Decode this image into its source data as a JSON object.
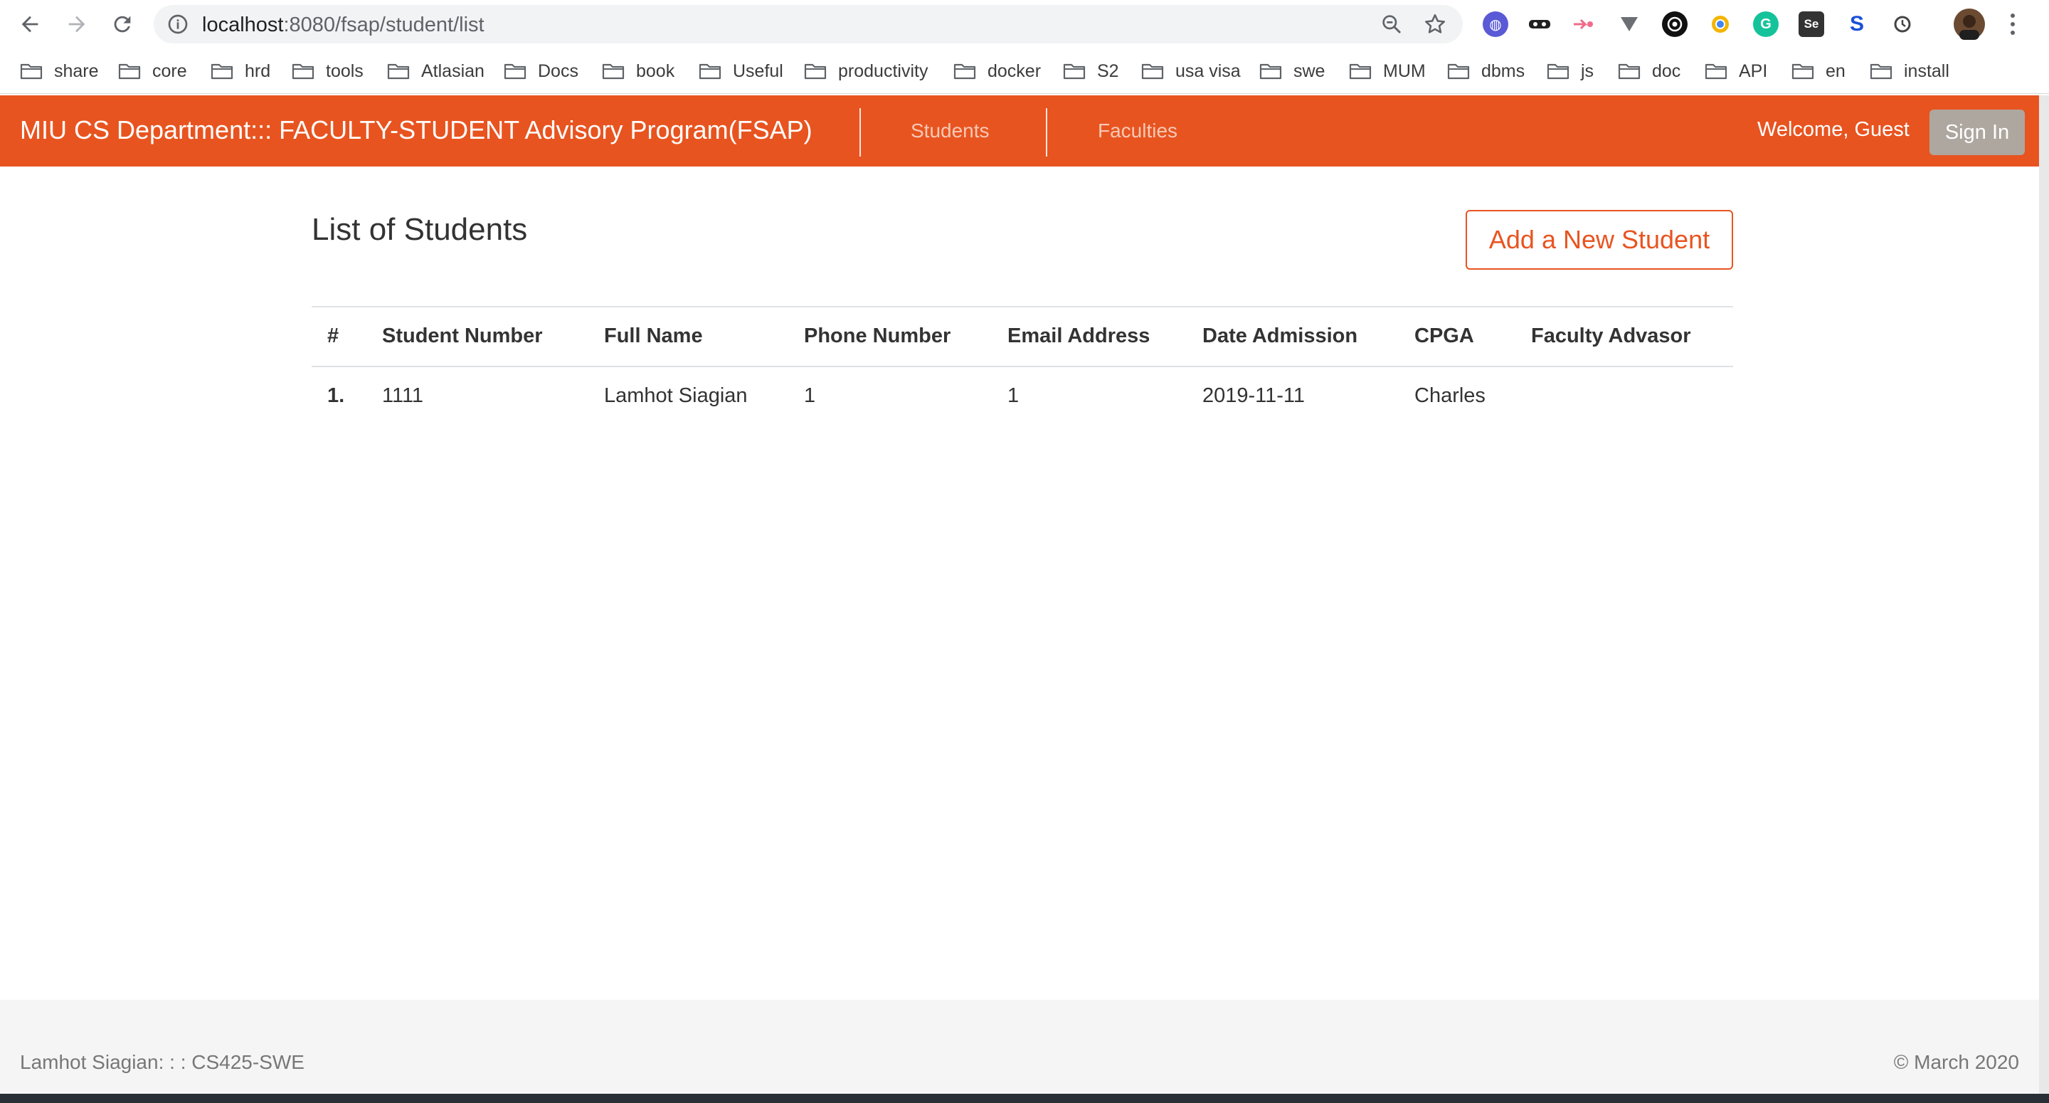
{
  "browser": {
    "url_host": "localhost",
    "url_path": ":8080/fsap/student/list",
    "extensions": [
      "globe-ext",
      "mask-ext",
      "pink-arrow-ext",
      "v-ext",
      "target-ext",
      "chrome-ext",
      "grammarly-ext",
      "se-ext",
      "s-ext",
      "sync-ext",
      "profile-avatar"
    ],
    "bookmarks": [
      "share",
      "core",
      "hrd",
      "tools",
      "Atlasian",
      "Docs",
      "book",
      "Useful",
      "productivity",
      "docker",
      "S2",
      "usa visa",
      "swe",
      "MUM",
      "dbms",
      "js",
      "doc",
      "API",
      "en",
      "install"
    ]
  },
  "navbar": {
    "brand": "MIU CS Department::: FACULTY-STUDENT Advisory Program(FSAP)",
    "links": [
      "Students",
      "Faculties"
    ],
    "welcome": "Welcome, Guest",
    "signin": "Sign In",
    "color": "#e85420"
  },
  "main": {
    "title": "List of Students",
    "add_button": "Add a New Student",
    "table": {
      "headers": [
        "#",
        "Student Number",
        "Full Name",
        "Phone Number",
        "Email Address",
        "Date Admission",
        "CPGA",
        "Faculty Advasor"
      ],
      "rows": [
        [
          "1.",
          "1111",
          "Lamhot Siagian",
          "1",
          "1",
          "2019-11-11",
          "Charles",
          ""
        ]
      ]
    }
  },
  "footer": {
    "left": "Lamhot Siagian: : : CS425-SWE",
    "right": "© March 2020"
  }
}
